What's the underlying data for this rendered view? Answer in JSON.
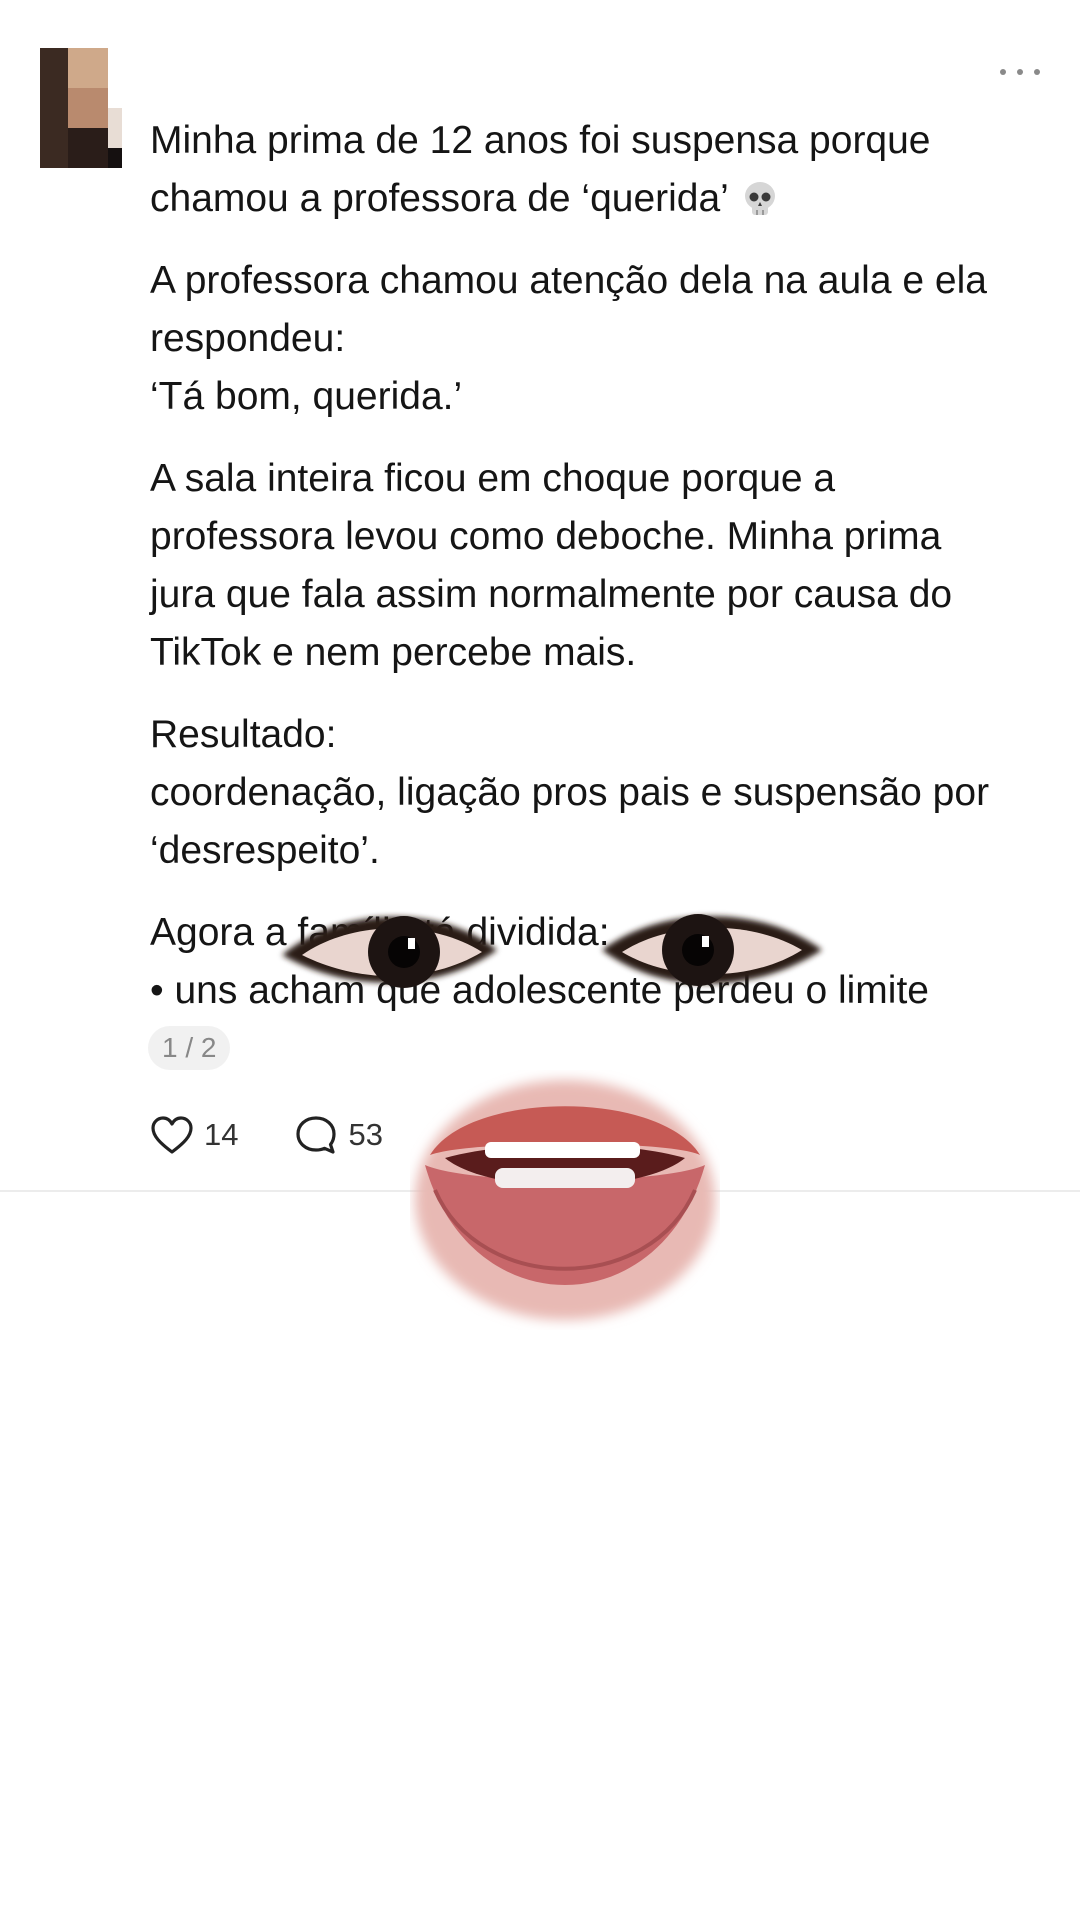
{
  "post": {
    "paragraphs": [
      {
        "lines": [
          "Minha prima de 12 anos foi suspensa porque",
          "chamou a professora de ‘querida’"
        ]
      },
      {
        "lines": [
          "A professora chamou atenção dela na aula e ela",
          "respondeu:",
          "‘Tá bom, querida.’"
        ]
      },
      {
        "lines": [
          "A sala inteira ficou em choque porque a",
          "professora levou como deboche. Minha prima",
          "jura que fala assim normalmente por causa do",
          "TikTok e nem percebe mais."
        ]
      },
      {
        "lines": [
          "Resultado:",
          "coordenação, ligação pros pais e suspensão por",
          "‘desrespeito’."
        ]
      },
      {
        "lines": [
          "Agora a família tá dividida:",
          "• uns acham que adolescente perdeu o limite"
        ]
      }
    ],
    "title_emoji_icon": "skull-icon",
    "page_indicator": "1 / 2",
    "likes": "14",
    "comments": "53"
  },
  "icons": {
    "more": "more-options-icon",
    "like": "heart-icon",
    "comment": "comment-bubble-icon"
  },
  "colors": {
    "text": "#151515",
    "muted": "#888888",
    "divider": "#ececec",
    "background": "#ffffff"
  }
}
